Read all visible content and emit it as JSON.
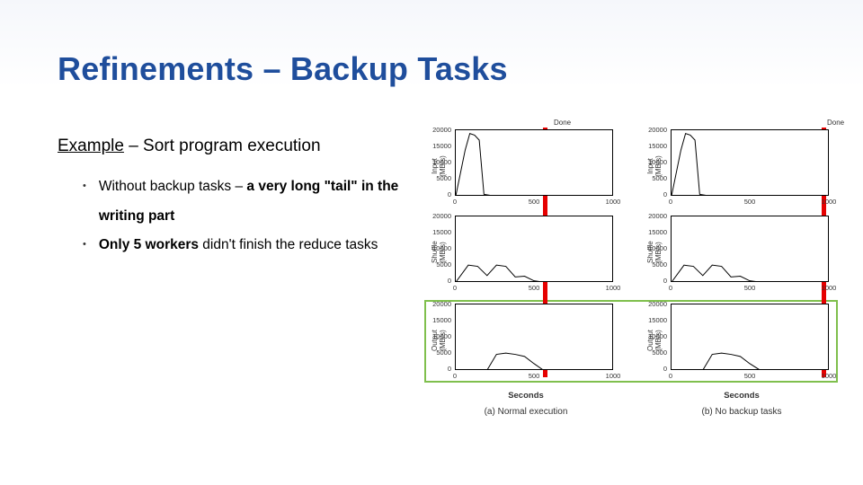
{
  "title": "Refinements – Backup Tasks",
  "example_prefix": "Example",
  "example_rest": " – Sort program execution",
  "bullets": [
    {
      "lead": "Without backup tasks – ",
      "bold": "a very long \"tail\" in the writing part"
    },
    {
      "bold": "Only 5 workers",
      "rest": " didn't finish the reduce tasks"
    }
  ],
  "figure": {
    "ylabels": [
      "Input (MB/s)",
      "Shuffle (MB/s)",
      "Output (MB/s)"
    ],
    "yticks": [
      "20000",
      "15000",
      "10000",
      "5000",
      "0"
    ],
    "xticks": [
      "0",
      "500",
      "1000"
    ],
    "xlabel": "Seconds",
    "done": "Done",
    "captions": [
      "(a) Normal execution",
      "(b) No backup tasks"
    ],
    "redline_x_a": 0.56,
    "redline_x_b": 0.96
  },
  "chart_data": [
    {
      "type": "line",
      "column": "a",
      "row": 0,
      "ylabel": "Input (MB/s)",
      "xlim": [
        0,
        1000
      ],
      "ylim": [
        0,
        20000
      ],
      "x": [
        0,
        60,
        90,
        120,
        150,
        180,
        220,
        280,
        560
      ],
      "y": [
        0,
        14000,
        19000,
        18500,
        17000,
        500,
        200,
        50,
        0
      ]
    },
    {
      "type": "line",
      "column": "a",
      "row": 1,
      "ylabel": "Shuffle (MB/s)",
      "xlim": [
        0,
        1000
      ],
      "ylim": [
        0,
        20000
      ],
      "x": [
        0,
        80,
        140,
        200,
        260,
        320,
        380,
        440,
        500,
        560
      ],
      "y": [
        0,
        5200,
        4800,
        2000,
        5200,
        4800,
        1600,
        1800,
        400,
        0
      ]
    },
    {
      "type": "line",
      "column": "a",
      "row": 2,
      "ylabel": "Output (MB/s)",
      "xlim": [
        0,
        1000
      ],
      "ylim": [
        0,
        20000
      ],
      "x": [
        0,
        200,
        260,
        320,
        380,
        440,
        500,
        560
      ],
      "y": [
        0,
        0,
        4800,
        5200,
        4800,
        4200,
        2000,
        0
      ]
    },
    {
      "type": "line",
      "column": "b",
      "row": 0,
      "ylabel": "Input (MB/s)",
      "xlim": [
        0,
        1000
      ],
      "ylim": [
        0,
        20000
      ],
      "x": [
        0,
        60,
        90,
        120,
        150,
        180,
        220,
        280,
        960
      ],
      "y": [
        0,
        14000,
        19000,
        18500,
        17000,
        500,
        200,
        50,
        0
      ]
    },
    {
      "type": "line",
      "column": "b",
      "row": 1,
      "ylabel": "Shuffle (MB/s)",
      "xlim": [
        0,
        1000
      ],
      "ylim": [
        0,
        20000
      ],
      "x": [
        0,
        80,
        140,
        200,
        260,
        320,
        380,
        440,
        500,
        560,
        960
      ],
      "y": [
        0,
        5200,
        4800,
        2000,
        5200,
        4800,
        1600,
        1800,
        400,
        50,
        0
      ]
    },
    {
      "type": "line",
      "column": "b",
      "row": 2,
      "ylabel": "Output (MB/s)",
      "xlim": [
        0,
        1000
      ],
      "ylim": [
        0,
        20000
      ],
      "x": [
        0,
        200,
        260,
        320,
        380,
        440,
        500,
        560,
        700,
        820,
        900,
        960
      ],
      "y": [
        0,
        0,
        4800,
        5200,
        4800,
        4200,
        2000,
        200,
        150,
        150,
        100,
        0
      ]
    }
  ]
}
